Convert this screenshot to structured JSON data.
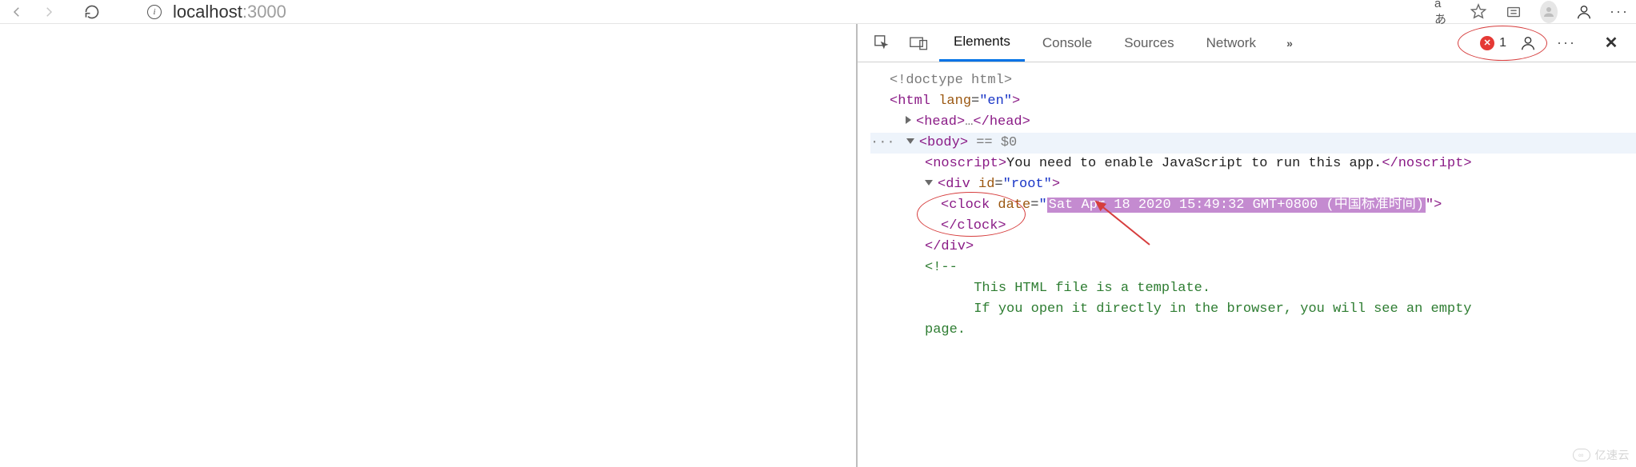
{
  "browser": {
    "url_host": "localhost",
    "url_port": ":3000",
    "translate_icon": "aあ",
    "favorite_icon": "☆+"
  },
  "devtools": {
    "tabs": {
      "elements": "Elements",
      "console": "Console",
      "sources": "Sources",
      "network": "Network",
      "more": "»"
    },
    "error_count": "1"
  },
  "dom": {
    "doctype": "<!doctype html>",
    "html_open1": "<",
    "html_tag": "html",
    "lang_attr": "lang",
    "lang_val": "\"en\"",
    "html_open2": ">",
    "head_open": "<head>",
    "head_ellipsis": "…",
    "head_close": "</head>",
    "body_open": "<body>",
    "body_inspect": " == $0",
    "noscript_open": "<noscript>",
    "noscript_text": "You need to enable JavaScript to run this app.",
    "noscript_close": "</noscript>",
    "div_open1": "<",
    "div_tag": "div",
    "id_attr": "id",
    "id_val": "\"root\"",
    "div_open2": ">",
    "clock_open1": "<",
    "clock_tag": "clock",
    "date_attr": "date",
    "date_val_hl": "Sat Apr 18 2020 15:49:32 GMT+0800 (中国标准时间)",
    "clock_open2": "\">",
    "clock_close": "</clock>",
    "div_close": "</div>",
    "comment_open": "<!--",
    "comment_l1": "      This HTML file is a template.",
    "comment_l2": "      If you open it directly in the browser, you will see an empty",
    "comment_l3": "page."
  },
  "watermark": {
    "text": "亿速云"
  }
}
